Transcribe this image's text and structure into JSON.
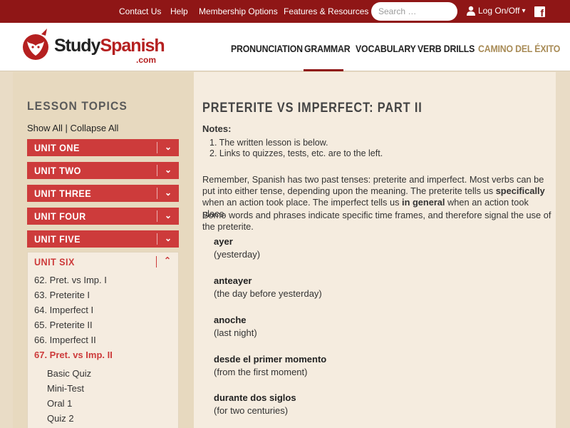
{
  "topbar": {
    "links": [
      "Contact Us",
      "Help",
      "Membership Options",
      "Features & Resources"
    ],
    "search_placeholder": "Search …",
    "login_label": "Log On/Off",
    "login_caret": "▾",
    "facebook_label": "f"
  },
  "header": {
    "logo_study": "Study",
    "logo_spanish": "Spanish",
    "logo_com": ".com",
    "nav": [
      "PRONUNCIATION",
      "GRAMMAR",
      "VOCABULARY",
      "VERB DRILLS",
      "CAMINO DEL ÉXITO"
    ],
    "active_nav": "GRAMMAR"
  },
  "sidebar": {
    "heading": "LESSON TOPICS",
    "show_all": "Show All",
    "divider": " | ",
    "collapse_all": "Collapse All",
    "units": [
      "UNIT ONE",
      "UNIT TWO",
      "UNIT THREE",
      "UNIT FOUR",
      "UNIT FIVE"
    ],
    "open_unit": {
      "label": "UNIT SIX",
      "lessons": [
        "62. Pret. vs Imp. I",
        "63. Preterite I",
        "64. Imperfect I",
        "65. Preterite II",
        "66. Imperfect II",
        "67. Pret. vs Imp. II"
      ],
      "active_lesson": "67. Pret. vs Imp. II",
      "sublinks": [
        "Basic Quiz",
        "Mini-Test",
        "Oral 1",
        "Quiz 2"
      ]
    },
    "chevron_down": "⌄",
    "chevron_up": "⌃"
  },
  "main": {
    "title": "PRETERITE VS IMPERFECT: PART II",
    "notes_label": "Notes:",
    "notes": [
      "1. The written lesson is below.",
      "2. Links to quizzes, tests, etc. are to the left."
    ],
    "para1_a": "Remember, Spanish has two past tenses: preterite and imperfect. Most verbs can be put into either tense, depending upon the meaning. The preterite tells us ",
    "para1_b": "specifically",
    "para1_c": " when an action took place. The imperfect tells us ",
    "para1_d": "in general",
    "para1_e": " when an action took place.",
    "para2": "Some words and phrases indicate specific time frames, and therefore signal the use of the preterite.",
    "terms": [
      {
        "es": "ayer",
        "en": "(yesterday)"
      },
      {
        "es": "anteayer",
        "en": "(the day before yesterday)"
      },
      {
        "es": "anoche",
        "en": "(last night)"
      },
      {
        "es": "desde el primer momento",
        "en": "(from the first moment)"
      },
      {
        "es": "durante dos siglos",
        "en": "(for two centuries)"
      }
    ]
  },
  "colors": {
    "brand_red": "#8f1616",
    "unit_red": "#cd3b3b",
    "background": "#e9dcc6",
    "content_bg": "#f5ecdf",
    "camino_gold": "#a88b56"
  }
}
